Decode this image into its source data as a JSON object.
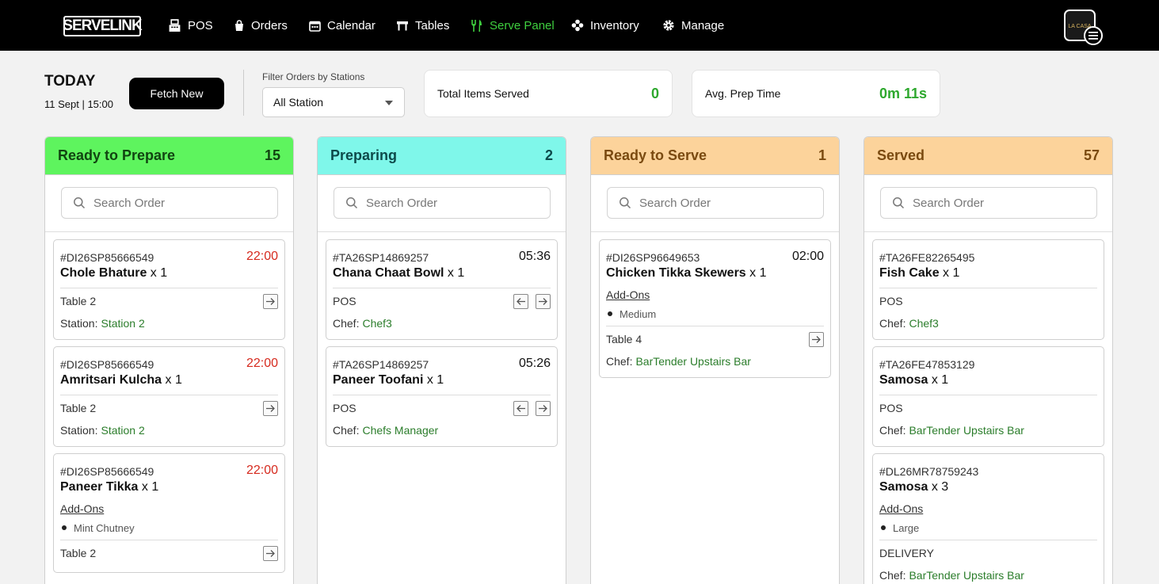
{
  "nav": {
    "logo": "SERVELINK",
    "items": [
      {
        "label": "POS",
        "icon": "register-icon"
      },
      {
        "label": "Orders",
        "icon": "bag-icon"
      },
      {
        "label": "Calendar",
        "icon": "calendar-icon"
      },
      {
        "label": "Tables",
        "icon": "table-icon"
      },
      {
        "label": "Serve Panel",
        "icon": "fork-knife-icon",
        "active": true
      },
      {
        "label": "Inventory",
        "icon": "flower-icon"
      },
      {
        "label": "Manage",
        "icon": "gear-icon"
      }
    ],
    "avatar_text": "LA CASA"
  },
  "header": {
    "today": "TODAY",
    "date": "11 Sept | 15:00",
    "fetch_label": "Fetch New",
    "filter_label": "Filter Orders by Stations",
    "filter_value": "All Station",
    "total_label": "Total Items Served",
    "total_value": "0",
    "avg_label": "Avg. Prep Time",
    "avg_value": "0m 11s"
  },
  "colors": {
    "ready_to_prepare": "#5ef45e",
    "preparing": "#7ff7ea",
    "ready_to_serve": "#fcd39b",
    "served": "#fcd39b",
    "accent_green": "#2b7d2b",
    "timer_red": "#d62a1e"
  },
  "columns": [
    {
      "title": "Ready to Prepare",
      "count": "15",
      "search_placeholder": "Search Order",
      "cards": [
        {
          "id": "#DI26SP85666549",
          "time": "22:00",
          "time_red": true,
          "name": "Chole Bhature",
          "qty": "x 1",
          "source": "Table 2",
          "meta_label": "Station:",
          "meta_value": "Station 2",
          "arrows": [
            "right"
          ]
        },
        {
          "id": "#DI26SP85666549",
          "time": "22:00",
          "time_red": true,
          "name": "Amritsari Kulcha",
          "qty": "x 1",
          "source": "Table 2",
          "meta_label": "Station:",
          "meta_value": "Station 2",
          "arrows": [
            "right"
          ]
        },
        {
          "id": "#DI26SP85666549",
          "time": "22:00",
          "time_red": true,
          "name": "Paneer Tikka",
          "qty": "x 1",
          "addons_label": "Add-Ons",
          "addons": [
            "Mint Chutney"
          ],
          "source": "Table 2",
          "arrows": [
            "right"
          ]
        }
      ]
    },
    {
      "title": "Preparing",
      "count": "2",
      "search_placeholder": "Search Order",
      "cards": [
        {
          "id": "#TA26SP14869257",
          "time": "05:36",
          "name": "Chana Chaat Bowl",
          "qty": "x 1",
          "source": "POS",
          "meta_label": "Chef:",
          "meta_value": "Chef3",
          "arrows": [
            "left",
            "right"
          ]
        },
        {
          "id": "#TA26SP14869257",
          "time": "05:26",
          "name": "Paneer Toofani",
          "qty": "x 1",
          "source": "POS",
          "meta_label": "Chef:",
          "meta_value": "Chefs Manager",
          "arrows": [
            "left",
            "right"
          ]
        }
      ]
    },
    {
      "title": "Ready to Serve",
      "count": "1",
      "search_placeholder": "Search Order",
      "cards": [
        {
          "id": "#DI26SP96649653",
          "time": "02:00",
          "name": "Chicken Tikka Skewers",
          "qty": "x 1",
          "addons_label": "Add-Ons",
          "addons": [
            "Medium"
          ],
          "source": "Table 4",
          "meta_label": "Chef:",
          "meta_value": "BarTender Upstairs Bar",
          "arrows": [
            "right"
          ]
        }
      ]
    },
    {
      "title": "Served",
      "count": "57",
      "search_placeholder": "Search Order",
      "cards": [
        {
          "id": "#TA26FE82265495",
          "name": "Fish Cake",
          "qty": "x 1",
          "source": "POS",
          "meta_label": "Chef:",
          "meta_value": "Chef3"
        },
        {
          "id": "#TA26FE47853129",
          "name": "Samosa",
          "qty": "x 1",
          "source": "POS",
          "meta_label": "Chef:",
          "meta_value": "BarTender Upstairs Bar"
        },
        {
          "id": "#DL26MR78759243",
          "name": "Samosa",
          "qty": "x 3",
          "addons_label": "Add-Ons",
          "addons": [
            "Large"
          ],
          "source": "DELIVERY",
          "meta_label": "Chef:",
          "meta_value": "BarTender Upstairs Bar"
        }
      ]
    }
  ]
}
